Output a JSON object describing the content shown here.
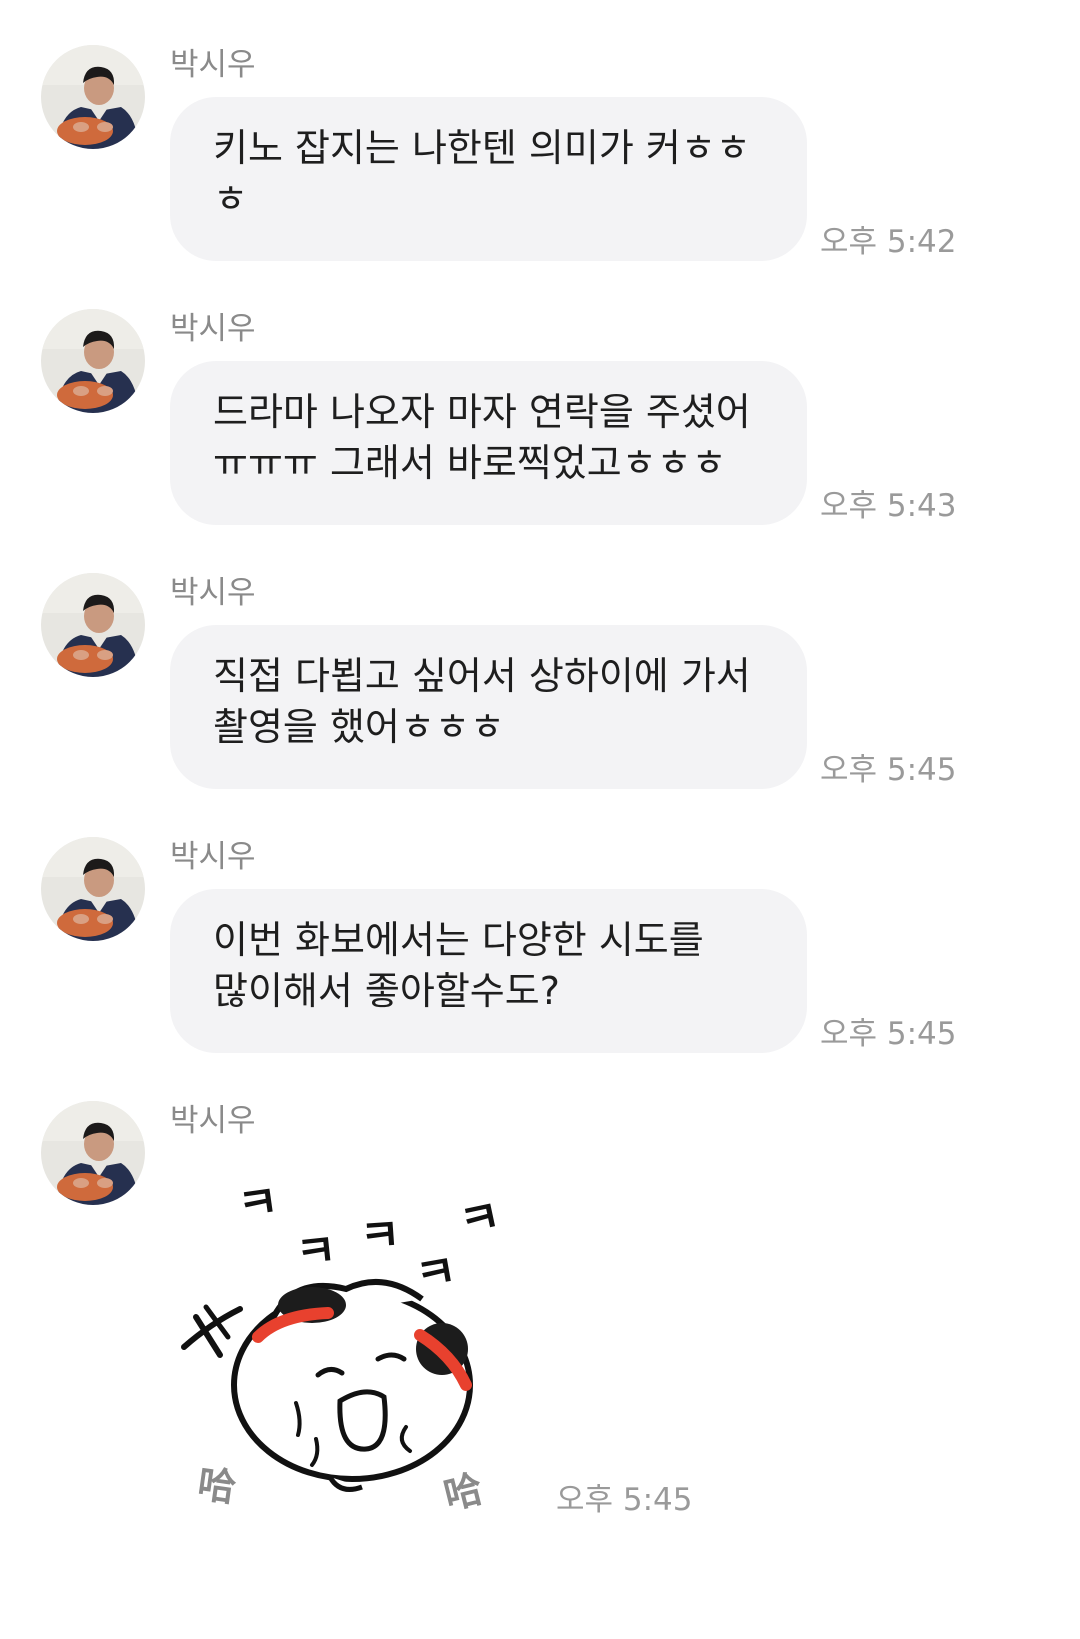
{
  "messages": [
    {
      "sender": "박시우",
      "lines": [
        "키노 잡지는 나한텐 의미가 커ㅎㅎ",
        "ㅎ"
      ],
      "time": "오후 5:42"
    },
    {
      "sender": "박시우",
      "lines": [
        "드라마 나오자 마자 연락을 주셨어",
        "ㅠㅠㅠ 그래서 바로찍었고ㅎㅎㅎ"
      ],
      "time": "오후 5:43"
    },
    {
      "sender": "박시우",
      "lines": [
        "직접 다뵙고 싶어서 상하이에 가서",
        "촬영을 했어ㅎㅎㅎ"
      ],
      "time": "오후 5:45"
    },
    {
      "sender": "박시우",
      "lines": [
        "이번 화보에서는 다양한 시도를",
        "많이해서 좋아할수도?"
      ],
      "time": "오후 5:45"
    },
    {
      "sender": "박시우",
      "sticker": {
        "icon": "laughing-dumpling-sticker",
        "text": [
          "ㅋ",
          "ㅋ",
          "ㅋ",
          "ㅋ",
          "ㅋ",
          "哈",
          "哈"
        ]
      },
      "time": "오후 5:45"
    }
  ],
  "colors": {
    "background": "#ffffff",
    "bubble": "#f3f3f5",
    "sender_text": "#8a8a8a",
    "time_text": "#9a9a9a",
    "message_text": "#1e1e1e",
    "sticker_accent": "#e8412e"
  }
}
